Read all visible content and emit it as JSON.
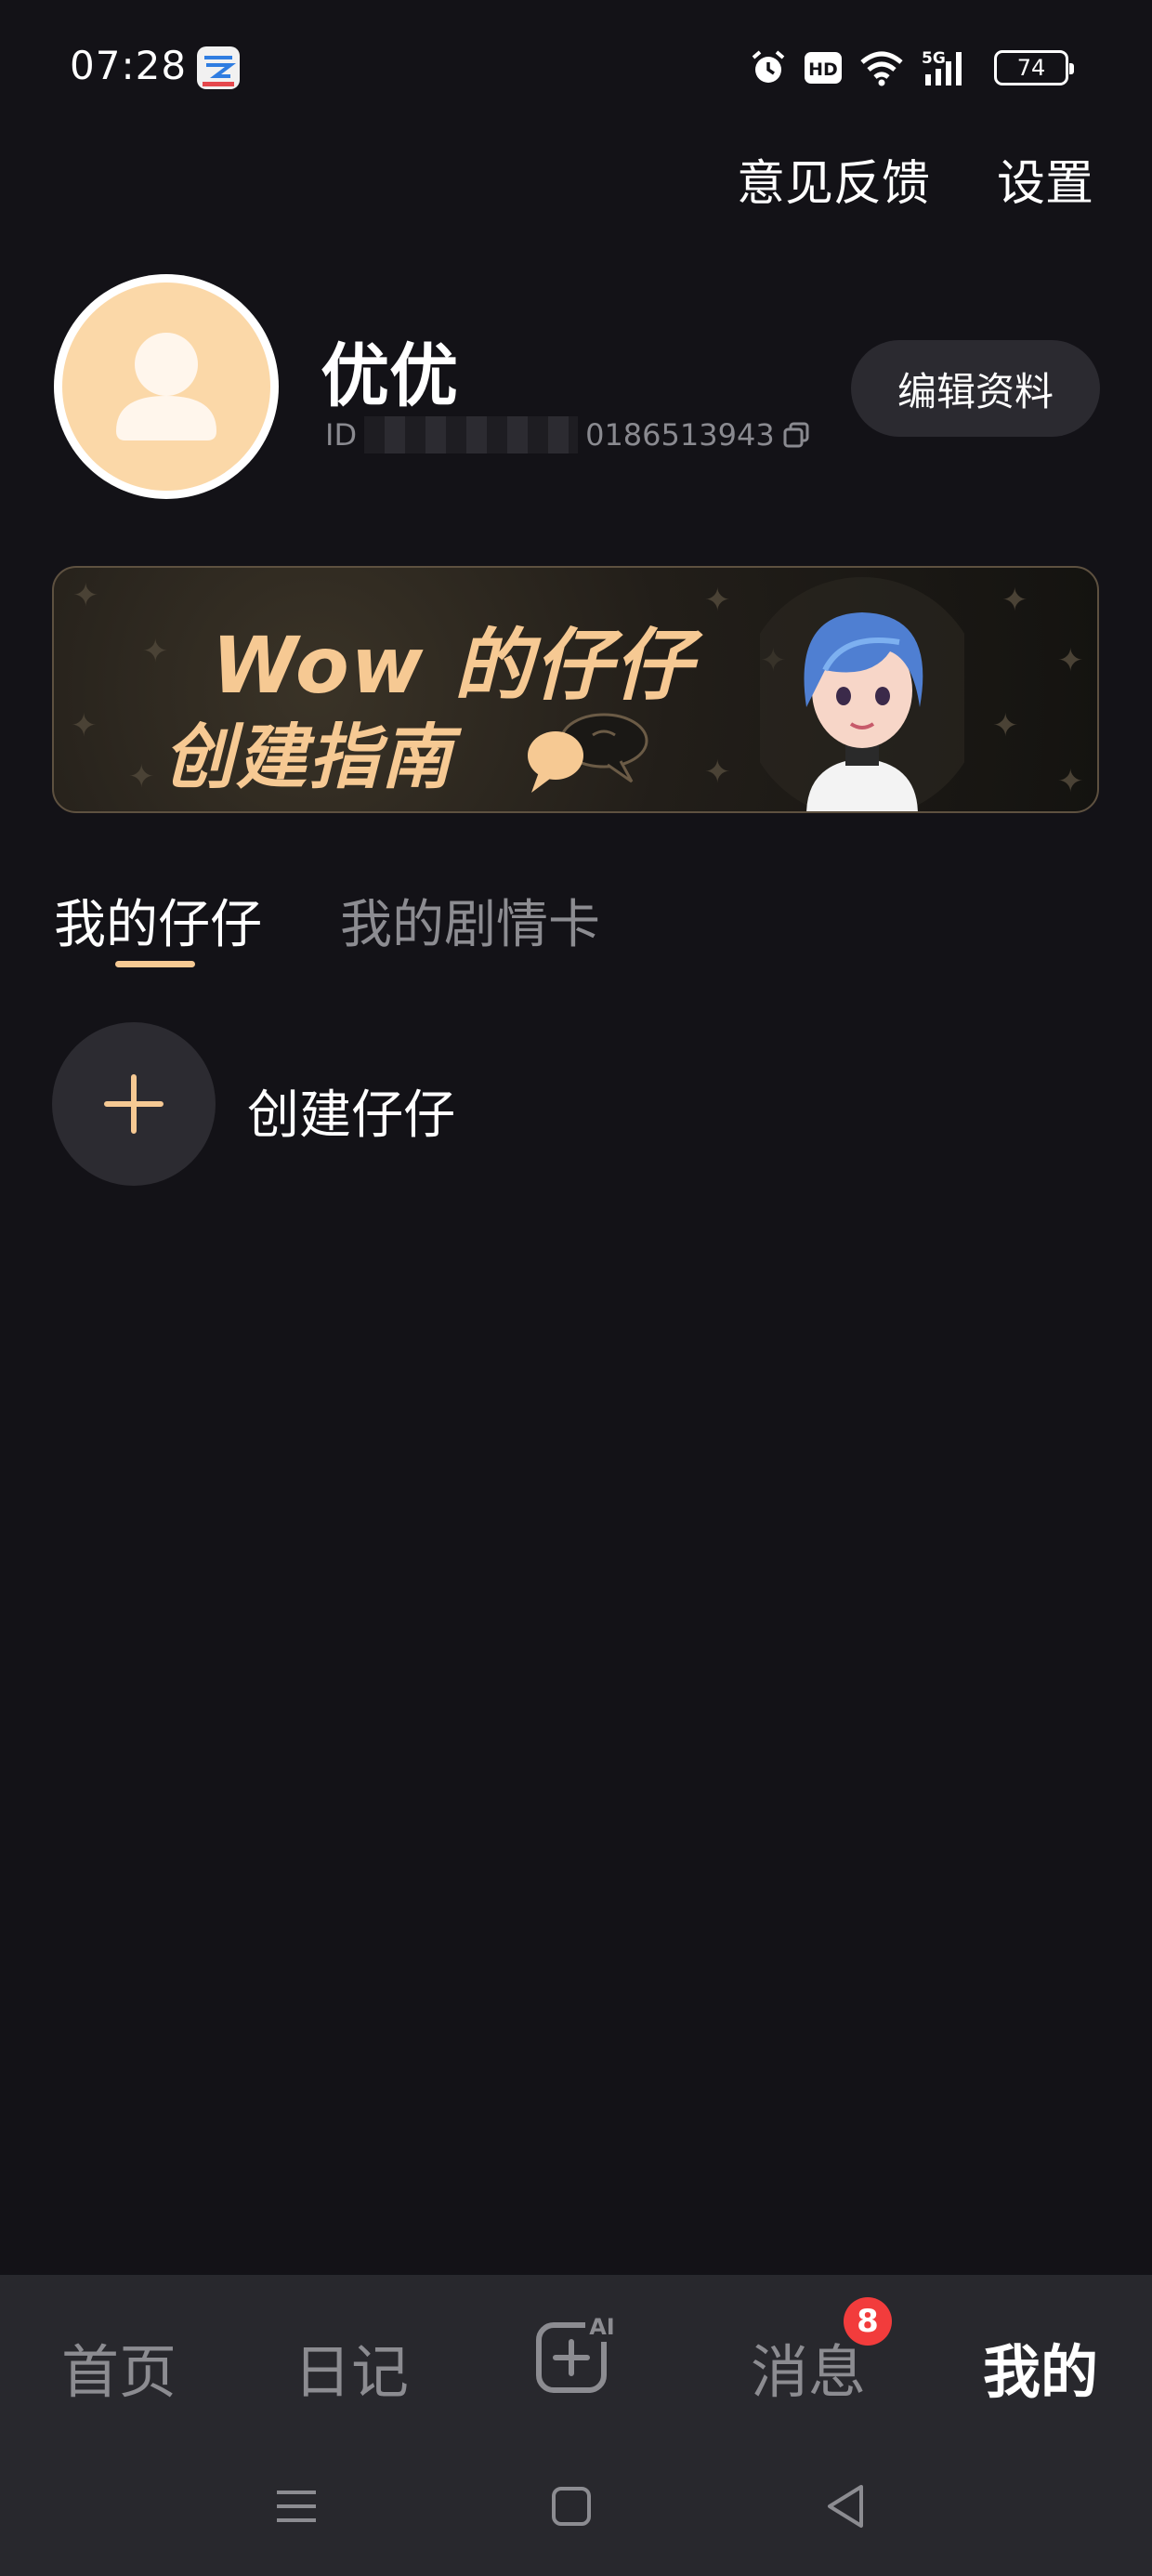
{
  "status_bar": {
    "time": "07:28",
    "app_icon": "cloud-app-icon",
    "icons": [
      "alarm-icon",
      "hd-icon",
      "wifi-icon",
      "5g-signal-icon"
    ],
    "hd_label": "HD",
    "network_label": "5G",
    "battery": "74"
  },
  "header": {
    "feedback_label": "意见反馈",
    "settings_label": "设置"
  },
  "profile": {
    "avatar_icon": "user-silhouette-icon",
    "name": "优优",
    "id_prefix": "ID",
    "id_visible_suffix": "0186513943",
    "copy_icon": "copy-icon",
    "edit_label": "编辑资料"
  },
  "banner": {
    "title": "Wow 的仔仔",
    "subtitle": "创建指南",
    "image": "anime-girl-blue-hair-illustration",
    "colors": {
      "accent": "#f6c993",
      "background": "#221e19"
    }
  },
  "tabs": [
    {
      "label": "我的仔仔",
      "active": true
    },
    {
      "label": "我的剧情卡",
      "active": false
    }
  ],
  "create": {
    "icon": "plus-icon",
    "label": "创建仔仔"
  },
  "bottom_nav": {
    "items": [
      {
        "label": "首页",
        "active": false
      },
      {
        "label": "日记",
        "active": false
      },
      {
        "icon": "ai-create-icon",
        "badge_text": "AI"
      },
      {
        "label": "消息",
        "active": false,
        "badge": "8"
      },
      {
        "label": "我的",
        "active": true
      }
    ]
  },
  "system_nav": [
    "menu-icon",
    "home-icon",
    "back-icon"
  ],
  "colors": {
    "page_background": "#131217",
    "nav_background": "#28282d",
    "badge": "#f23c3c"
  }
}
